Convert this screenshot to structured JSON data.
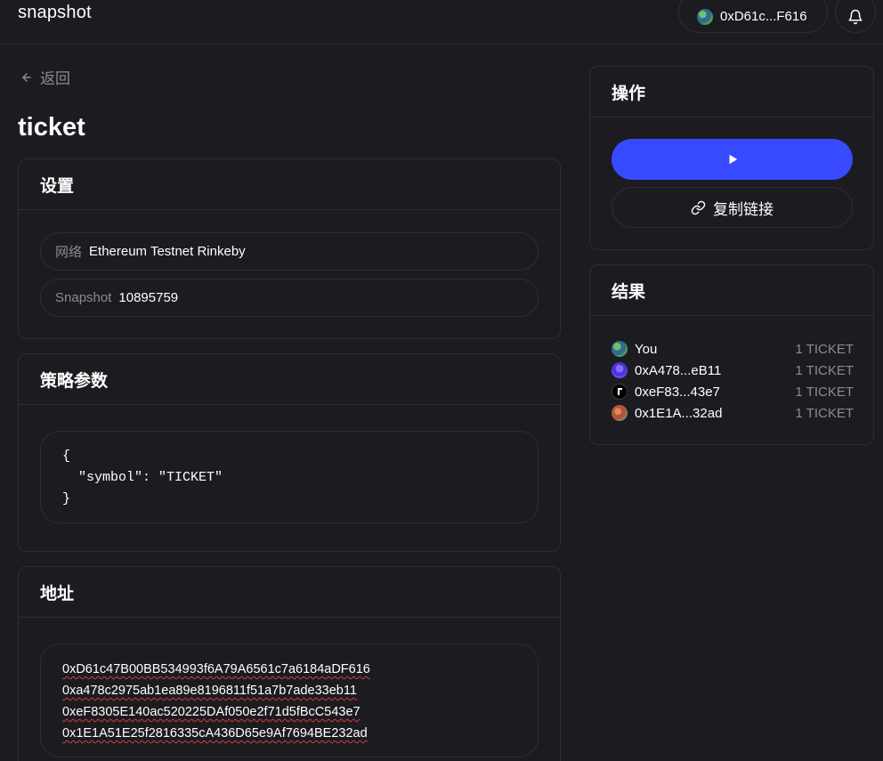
{
  "header": {
    "brand": "snapshot",
    "account": "0xD61c...F616"
  },
  "nav": {
    "back_label": "返回"
  },
  "page": {
    "title": "ticket"
  },
  "settings": {
    "title": "设置",
    "network_label": "网络",
    "network_value": "Ethereum Testnet Rinkeby",
    "snapshot_label": "Snapshot",
    "snapshot_value": "10895759"
  },
  "strategy": {
    "title": "策略参数",
    "code_lines": [
      "{",
      "  \"symbol\": \"TICKET\"",
      "}"
    ]
  },
  "addresses": {
    "title": "地址",
    "items": [
      "0xD61c47B00BB534993f6A79A6561c7a6184aDF616",
      "0xa478c2975ab1ea89e8196811f51a7b7ade33eb11",
      "0xeF8305E140ac520225DAf050e2f71d5fBcC543e7",
      "0x1E1A51E25f2816335cA436D65e9Af7694BE232ad"
    ]
  },
  "actions": {
    "title": "操作",
    "copy_label": "复制链接"
  },
  "results": {
    "title": "结果",
    "rows": [
      {
        "name": "You",
        "amount": "1 TICKET",
        "avatar_color": "#3f8f6a"
      },
      {
        "name": "0xA478...eB11",
        "amount": "1 TICKET",
        "avatar_color": "#6a4cff"
      },
      {
        "name": "0xeF83...43e7",
        "amount": "1 TICKET",
        "avatar_color": "#000000"
      },
      {
        "name": "0x1E1A...32ad",
        "amount": "1 TICKET",
        "avatar_color": "#c9643c"
      }
    ]
  },
  "colors": {
    "background": "#1c1b20",
    "border": "#2d2d33",
    "primary": "#384aff",
    "muted_text": "#8b8b93"
  }
}
